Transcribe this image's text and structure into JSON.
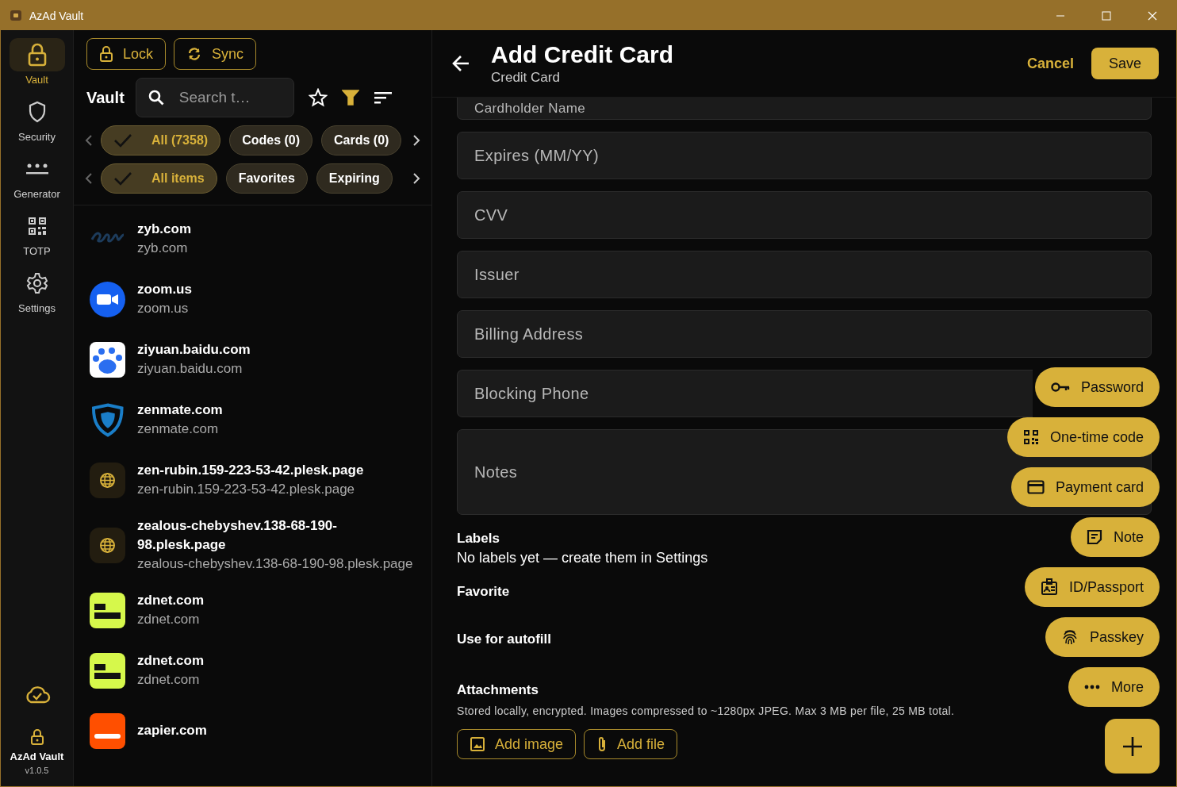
{
  "window": {
    "title": "AzAd Vault"
  },
  "nav": {
    "items": [
      {
        "label": "Vault",
        "selected": true
      },
      {
        "label": "Security",
        "selected": false
      },
      {
        "label": "Generator",
        "selected": false
      },
      {
        "label": "TOTP",
        "selected": false
      },
      {
        "label": "Settings",
        "selected": false
      }
    ],
    "app_name": "AzAd Vault",
    "version": "v1.0.5"
  },
  "toolbar": {
    "buttons": [
      "Lock",
      "Sync"
    ]
  },
  "list_header": {
    "title": "Vault",
    "search": {
      "placeholder": "Search t…"
    },
    "filter_on": true
  },
  "type_chips": [
    {
      "label": "All (7358)",
      "selected": true
    },
    {
      "label": "Codes (0)",
      "selected": false
    },
    {
      "label": "Cards (0)",
      "selected": false
    }
  ],
  "filter_chips": [
    {
      "label": "All items",
      "selected": true
    },
    {
      "label": "Favorites",
      "selected": false
    },
    {
      "label": "Expiring",
      "selected": false
    }
  ],
  "items": [
    {
      "title": "zyb.com",
      "subtitle": "zyb.com"
    },
    {
      "title": "zoom.us",
      "subtitle": "zoom.us"
    },
    {
      "title": "ziyuan.baidu.com",
      "subtitle": "ziyuan.baidu.com"
    },
    {
      "title": "zenmate.com",
      "subtitle": "zenmate.com"
    },
    {
      "title": "zen-rubin.159-223-53-42.plesk.page",
      "subtitle": "zen-rubin.159-223-53-42.plesk.page"
    },
    {
      "title": "zealous-chebyshev.138-68-190-98.plesk.page",
      "subtitle": "zealous-chebyshev.138-68-190-98.plesk.page"
    },
    {
      "title": "zdnet.com",
      "subtitle": "zdnet.com"
    },
    {
      "title": "zdnet.com",
      "subtitle": "zdnet.com"
    },
    {
      "title": "zapier.com"
    }
  ],
  "editor": {
    "title": "Add Credit Card",
    "subtitle": "Credit Card",
    "cancel": "Cancel",
    "save": "Save",
    "fields": [
      {
        "placeholder": "Cardholder Name",
        "kind": "cut"
      },
      {
        "placeholder": "Expires (MM/YY)",
        "kind": "line"
      },
      {
        "placeholder": "CVV",
        "kind": "line"
      },
      {
        "placeholder": "Issuer",
        "kind": "line"
      },
      {
        "placeholder": "Billing Address",
        "kind": "line"
      },
      {
        "placeholder": "Blocking Phone",
        "kind": "line"
      },
      {
        "placeholder": "Notes",
        "kind": "multiline"
      }
    ],
    "labels_heading": "Labels",
    "labels_note": "No labels yet — create them in Settings",
    "favorite": "Favorite",
    "autofill": "Use for autofill",
    "attachments_heading": "Attachments",
    "attachments_note": "Stored locally, encrypted. Images compressed to ~1280px JPEG. Max 3 MB per file, 25 MB total.",
    "attachment_buttons": [
      "Add image",
      "Add file"
    ]
  },
  "fab_menu": [
    "Password",
    "One-time code",
    "Payment card",
    "Note",
    "ID/Passport",
    "Passkey",
    "More"
  ]
}
